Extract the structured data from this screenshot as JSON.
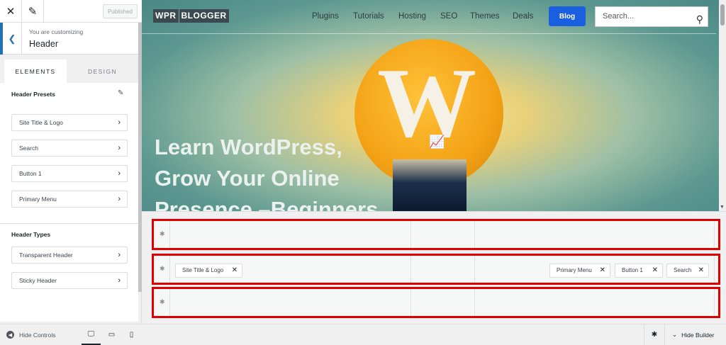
{
  "sidebar": {
    "close_icon": "close-icon",
    "edit_icon": "pencil-icon",
    "publish_label": "Published",
    "context_sub": "You are customizing",
    "context_title": "Header",
    "tabs": [
      {
        "label": "ELEMENTS"
      },
      {
        "label": "DESIGN"
      }
    ],
    "presets_title": "Header Presets",
    "presets": [
      {
        "label": "Site Title & Logo"
      },
      {
        "label": "Search"
      },
      {
        "label": "Button 1"
      },
      {
        "label": "Primary Menu"
      }
    ],
    "types_title": "Header Types",
    "types": [
      {
        "label": "Transparent Header"
      },
      {
        "label": "Sticky Header"
      }
    ],
    "hide_controls": "Hide Controls"
  },
  "preview": {
    "logo_a": "WPR",
    "logo_b": "BLOGGER",
    "nav": [
      "Plugins",
      "Tutorials",
      "Hosting",
      "SEO",
      "Themes",
      "Deals"
    ],
    "blog_button": "Blog",
    "search_placeholder": "Search...",
    "hero_lines": [
      "Learn WordPress,",
      "Grow Your Online",
      "Presence –Beginners"
    ]
  },
  "builder": {
    "middle_row_chips": {
      "left": "Site Title & Logo",
      "right": [
        "Primary Menu",
        "Button 1",
        "Search"
      ]
    },
    "hide_builder": "Hide Builder",
    "highlight_color": "#e00000"
  }
}
